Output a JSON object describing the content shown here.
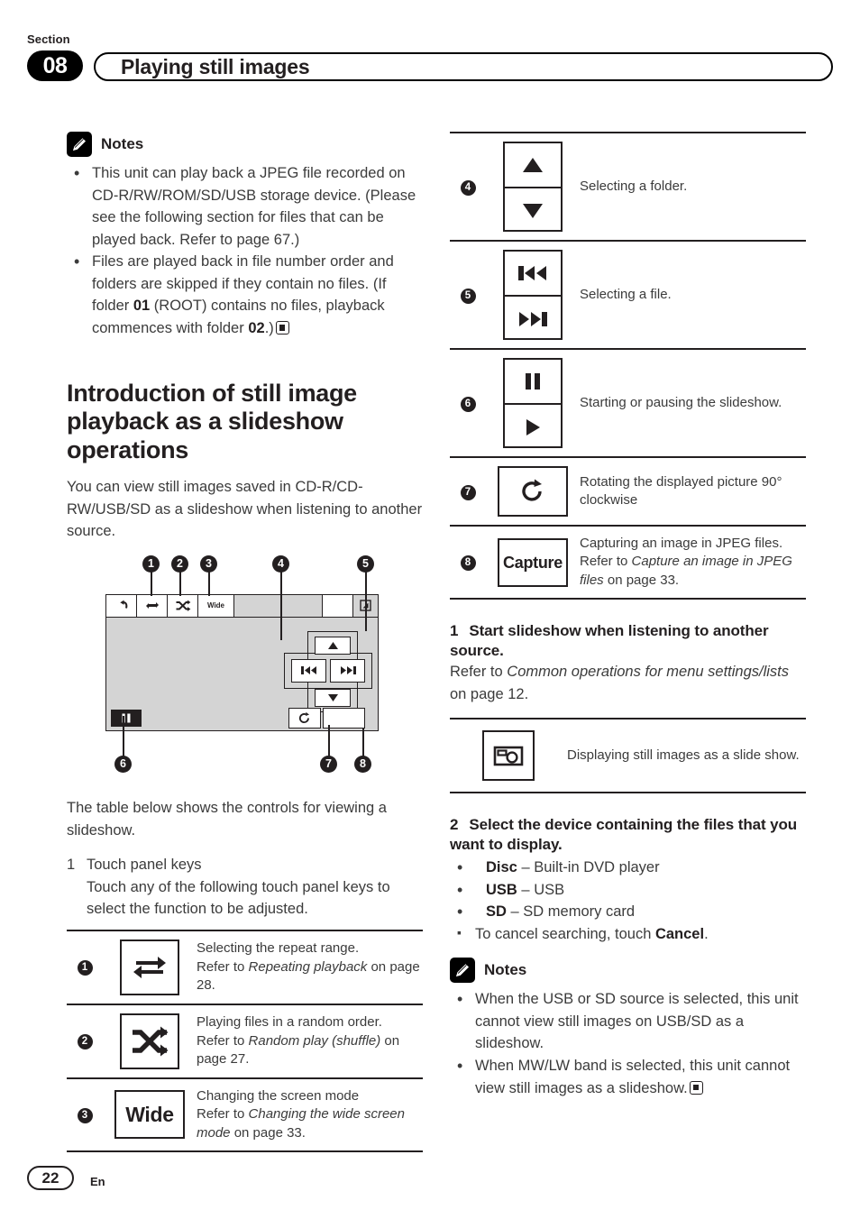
{
  "header": {
    "section_label": "Section",
    "section_number": "08",
    "title": "Playing still images"
  },
  "left_column": {
    "notes_top": {
      "label": "Notes",
      "items": [
        "This unit can play back a JPEG file recorded on CD-R/RW/ROM/SD/USB storage device. (Please see the following section for files that can be played back. Refer to page 67.)",
        "Files are played back in file number order and folders are skipped if they contain no files. (If folder 01 (ROOT) contains no files, playback commences with folder 02.)"
      ]
    },
    "section_title": "Introduction of still image playback as a slideshow operations",
    "intro_paragraph": "You can view still images saved in CD-R/CD-RW/USB/SD as a slideshow when listening to another source.",
    "device_figure": {
      "callouts": [
        "1",
        "2",
        "3",
        "4",
        "5",
        "6",
        "7",
        "8"
      ],
      "top_keys": [
        "back-icon",
        "repeat-icon",
        "shuffle-icon",
        "Wide"
      ],
      "nav_keys": [
        "up-arrow",
        "down-arrow",
        "previous-track",
        "next-track"
      ],
      "bottom_keys": [
        "pause-icon",
        "rotate-icon",
        "capture-blank"
      ]
    },
    "table_intro": "The table below shows the controls for viewing a slideshow.",
    "list_number": "1",
    "list_title": "Touch panel keys",
    "list_body": "Touch any of the following touch panel keys to select the function to be adjusted.",
    "key_table": [
      {
        "num": "1",
        "icon": "repeat-icon",
        "desc_1": "Selecting the repeat range.",
        "desc_2_prefix": "Refer to ",
        "desc_2_italic": "Repeating playback",
        "desc_2_suffix": " on page 28."
      },
      {
        "num": "2",
        "icon": "shuffle-icon",
        "desc_1": "Playing files in a random order.",
        "desc_2_prefix": "Refer to ",
        "desc_2_italic": "Random play (shuffle)",
        "desc_2_suffix": " on page 27."
      },
      {
        "num": "3",
        "icon": "Wide",
        "desc_1": "Changing the screen mode",
        "desc_2_prefix": "Refer to ",
        "desc_2_italic": "Changing the wide screen mode",
        "desc_2_suffix": " on page 33."
      }
    ]
  },
  "right_column": {
    "key_table": [
      {
        "num": "4",
        "icon": "up-down-arrows-icon",
        "desc_1": "Selecting a folder.",
        "desc_2_prefix": "",
        "desc_2_italic": "",
        "desc_2_suffix": ""
      },
      {
        "num": "5",
        "icon": "prev-next-track-icon",
        "desc_1": "Selecting a file.",
        "desc_2_prefix": "",
        "desc_2_italic": "",
        "desc_2_suffix": ""
      },
      {
        "num": "6",
        "icon": "pause-play-icon",
        "desc_1": "Starting or pausing the slideshow.",
        "desc_2_prefix": "",
        "desc_2_italic": "",
        "desc_2_suffix": ""
      },
      {
        "num": "7",
        "icon": "rotate-icon",
        "desc_1": "Rotating the displayed picture 90° clockwise",
        "desc_2_prefix": "",
        "desc_2_italic": "",
        "desc_2_suffix": ""
      },
      {
        "num": "8",
        "icon": "Capture",
        "desc_1": "Capturing an image in JPEG files.",
        "desc_2_prefix": "Refer to ",
        "desc_2_italic": "Capture an image in JPEG files",
        "desc_2_suffix": " on page 33."
      }
    ],
    "step_1": {
      "number": "1",
      "heading": "Start slideshow when listening to another source.",
      "body_prefix": "Refer to ",
      "body_italic": "Common operations for menu settings/lists",
      "body_suffix": " on page 12."
    },
    "slideshow_row": {
      "icon": "camera-icon",
      "desc": "Displaying still images as a slide show."
    },
    "step_2": {
      "number": "2",
      "heading": "Select the device containing the files that you want to display.",
      "options": [
        {
          "name": "Disc",
          "dash": " – ",
          "desc": "Built-in DVD player"
        },
        {
          "name": "USB",
          "dash": " – ",
          "desc": "USB"
        },
        {
          "name": "SD",
          "dash": " – ",
          "desc": "SD memory card"
        }
      ],
      "cancel_prefix": "To cancel searching, touch ",
      "cancel_bold": "Cancel",
      "cancel_suffix": "."
    },
    "notes_bottom": {
      "label": "Notes",
      "items": [
        "When the USB or SD source is selected, this unit cannot view still images on USB/SD as a slideshow.",
        "When MW/LW band is selected, this unit cannot view still images as a slideshow."
      ]
    }
  },
  "footer": {
    "page_number": "22",
    "language": "En"
  }
}
